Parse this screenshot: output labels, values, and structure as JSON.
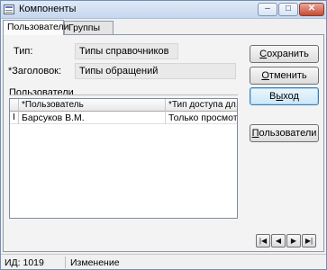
{
  "window": {
    "title": "Компоненты",
    "controls": {
      "minimize": "–",
      "maximize": "□",
      "close": "✕"
    }
  },
  "tabs": [
    {
      "label": "Пользователи",
      "active": true
    },
    {
      "label": "Группы",
      "active": false
    }
  ],
  "fields": {
    "type_label": "Тип:",
    "type_value": "Типы справочников",
    "header_label": "*Заголовок:",
    "header_value": "Типы обращений"
  },
  "users_group": {
    "caption": "Пользователи",
    "columns": [
      "*Пользователь",
      "*Тип доступа дл..."
    ],
    "rows": [
      {
        "indicator": "I",
        "user": "Барсуков В.М.",
        "access": "Только просмотр"
      }
    ]
  },
  "buttons": {
    "save": {
      "label_ul": "С",
      "label_rest": "охранить"
    },
    "cancel": {
      "label_ul": "О",
      "label_rest": "тменить"
    },
    "exit": {
      "label_pre": "В",
      "label_ul": "ы",
      "label_rest": "ход"
    },
    "users": {
      "label_ul": "П",
      "label_rest": "ользователи"
    }
  },
  "navigator": {
    "first": "|◀",
    "prev": "◀",
    "next": "▶",
    "last": "▶|"
  },
  "status": {
    "id": "ИД: 1019",
    "mode": "Изменение"
  }
}
